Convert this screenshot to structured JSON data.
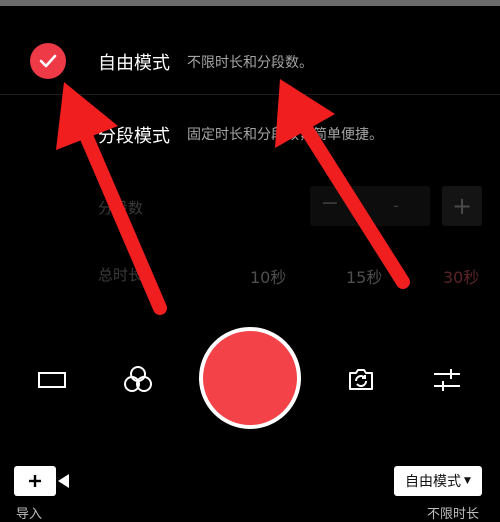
{
  "colors": {
    "accent": "#ee3a46",
    "record": "#f44249",
    "annotation": "#f01e1e",
    "dim_text": "#3a3a3a",
    "desc_text": "#a4a4a4"
  },
  "modes": [
    {
      "title": "自由模式",
      "description": "不限时长和分段数。",
      "selected": true,
      "icon": "check-icon"
    },
    {
      "title": "分段模式",
      "description": "固定时长和分段数，简单便捷。",
      "selected": false
    }
  ],
  "segments": {
    "label": "分段数",
    "minus": "−",
    "value": "-",
    "plus": "+"
  },
  "duration": {
    "label": "总时长",
    "options": [
      "10秒",
      "15秒",
      "30秒"
    ]
  },
  "controls": {
    "icons": [
      "aspect-ratio-icon",
      "filter-icon",
      "camera-flip-icon",
      "settings-sliders-icon"
    ]
  },
  "import": {
    "icon": "plus-icon",
    "label": "导入"
  },
  "mode_select": {
    "value": "自由模式",
    "caret": "▼",
    "subtitle": "不限时长"
  },
  "annotations": [
    "arrow-to-check",
    "arrow-to-description"
  ]
}
